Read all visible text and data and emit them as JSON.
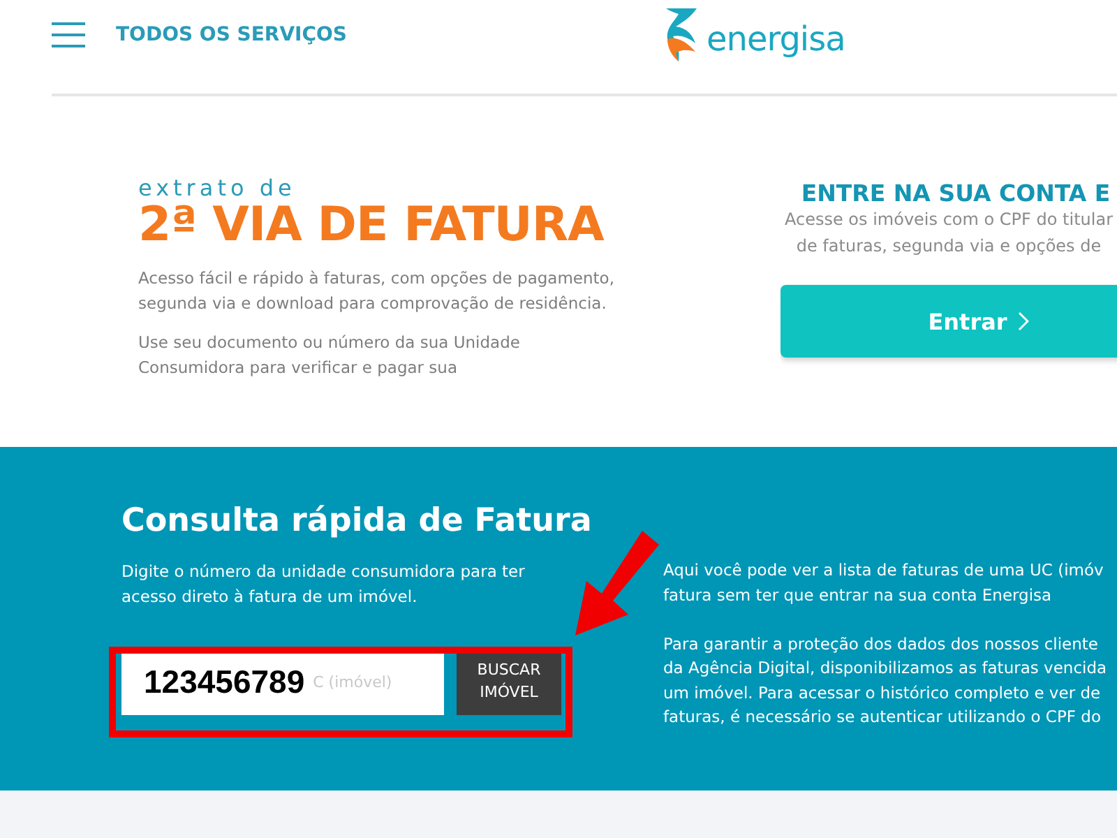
{
  "header": {
    "menu_label": "TODOS OS SERVIÇOS",
    "logo_text": "energisa"
  },
  "hero": {
    "kicker": "extrato de",
    "title": "2ª VIA DE FATURA",
    "paragraphs": [
      "Acesso fácil e rápido à faturas, com opções de pagamento, segunda via e download para comprovação de residência.",
      "Use seu documento ou número da sua Unidade Consumidora para verificar e pagar sua"
    ]
  },
  "account": {
    "title": "ENTRE NA SUA CONTA E",
    "lines": [
      "Acesse os imóveis com o CPF do titular",
      "de faturas, segunda via e opções de"
    ],
    "button": "Entrar"
  },
  "quick": {
    "title": "Consulta rápida de Fatura",
    "description": "Digite o número da unidade consumidora para ter acesso direto à fatura de um imóvel.",
    "field": {
      "value": "123456789",
      "placeholder": "C (imóvel)"
    },
    "button": "BUSCAR IMÓVEL",
    "info_lines": [
      "Aqui você pode ver a lista de faturas de uma UC (imóv",
      "fatura sem ter que entrar na sua conta Energisa",
      "Para garantir a proteção dos dados dos nossos cliente",
      "da Agência Digital, disponibilizamos as faturas vencida",
      "um imóvel. Para acessar o histórico completo e ver de",
      "faturas, é necessário se autenticar utilizando o CPF do"
    ]
  }
}
